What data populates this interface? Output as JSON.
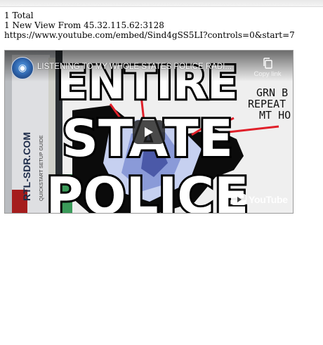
{
  "stats": {
    "total_count": "1",
    "total_label": "Total",
    "new_count": "1",
    "new_label": "New View From 45.32.115.62:3128"
  },
  "embed_url": "https://www.youtube.com/embed/Sind4gSS5LI?controls=0&start=7",
  "video": {
    "title": "LISTENING TO MY WHOLE STATES POLICE RADI...",
    "copy_link_label": "Copy link",
    "brand_label": "YouTube",
    "thumbnail_text": {
      "line1": "ENTIRE",
      "line2": "STATE",
      "line3": "POLICE",
      "side_label": "RTL-SDR.COM",
      "map_label_1": "GRN B",
      "map_label_2": "REPEAT",
      "map_label_3": "MT HO"
    }
  },
  "colors": {
    "red_path": "#e0202a",
    "play_bg": "#212121"
  },
  "icons": {
    "play": "play-icon",
    "copy": "copy-link-icon",
    "logo": "youtube-logo-icon",
    "channel": "channel-avatar-icon"
  }
}
